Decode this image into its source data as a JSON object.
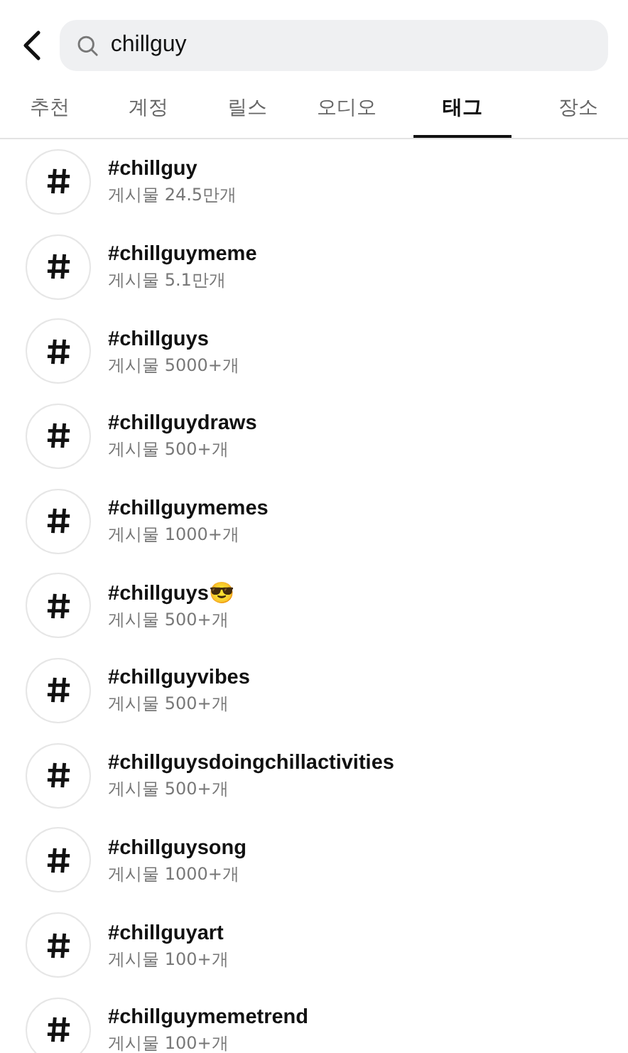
{
  "search": {
    "value": "chillguy"
  },
  "tabs": [
    {
      "label": "추천",
      "selected": false
    },
    {
      "label": "계정",
      "selected": false
    },
    {
      "label": "릴스",
      "selected": false
    },
    {
      "label": "오디오",
      "selected": false
    },
    {
      "label": "태그",
      "selected": true
    },
    {
      "label": "장소",
      "selected": false
    }
  ],
  "results": [
    {
      "tag": "#chillguy",
      "count": "게시물 24.5만개"
    },
    {
      "tag": "#chillguymeme",
      "count": "게시물 5.1만개"
    },
    {
      "tag": "#chillguys",
      "count": "게시물 5000+개"
    },
    {
      "tag": "#chillguydraws",
      "count": "게시물 500+개"
    },
    {
      "tag": "#chillguymemes",
      "count": "게시물 1000+개"
    },
    {
      "tag": "#chillguys😎",
      "count": "게시물 500+개"
    },
    {
      "tag": "#chillguyvibes",
      "count": "게시물 500+개"
    },
    {
      "tag": "#chillguysdoingchillactivities",
      "count": "게시물 500+개"
    },
    {
      "tag": "#chillguysong",
      "count": "게시물 1000+개"
    },
    {
      "tag": "#chillguyart",
      "count": "게시물 100+개"
    },
    {
      "tag": "#chillguymemetrend",
      "count": "게시물 100+개"
    }
  ]
}
